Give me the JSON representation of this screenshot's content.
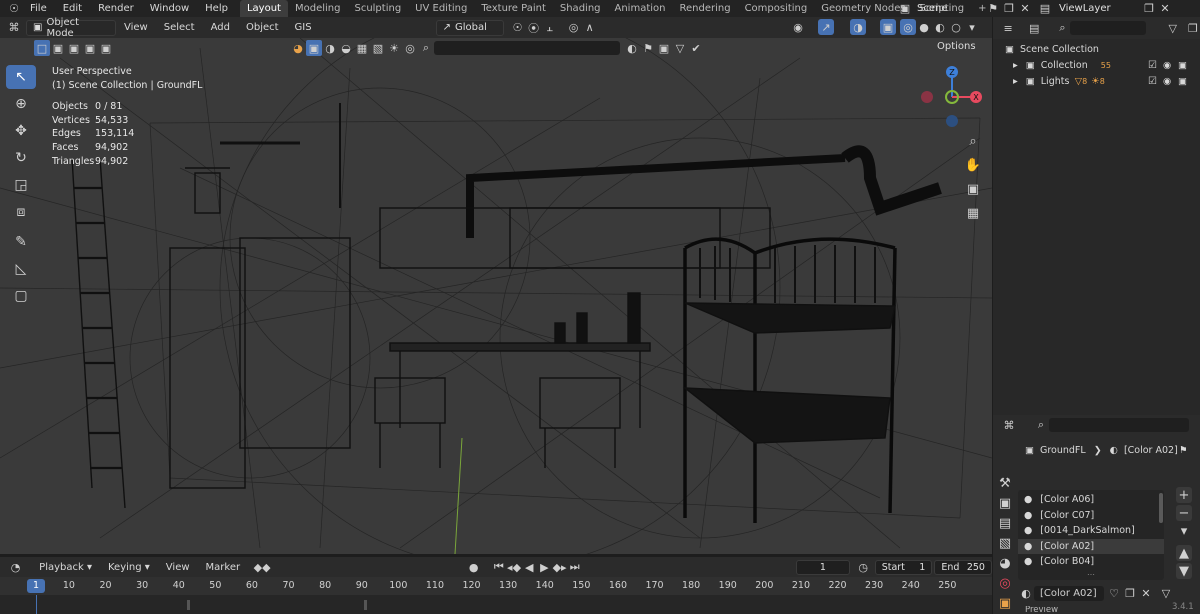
{
  "topbar": {
    "menus": [
      "File",
      "Edit",
      "Render",
      "Window",
      "Help"
    ],
    "workspaces": [
      "Layout",
      "Modeling",
      "Sculpting",
      "UV Editing",
      "Texture Paint",
      "Shading",
      "Animation",
      "Rendering",
      "Compositing",
      "Geometry Nodes",
      "Scripting"
    ],
    "active_workspace": "Layout",
    "scene_label": "Scene",
    "view_layer_label": "ViewLayer"
  },
  "viewport_header": {
    "mode": "Object Mode",
    "menus": [
      "View",
      "Select",
      "Add",
      "Object",
      "GIS"
    ],
    "orientation": "Global",
    "options_label": "Options"
  },
  "viewport": {
    "view_name": "User Perspective",
    "collection_path": "(1) Scene Collection | GroundFL",
    "stats": [
      {
        "label": "Objects",
        "value": "0 / 81"
      },
      {
        "label": "Vertices",
        "value": "54,533"
      },
      {
        "label": "Edges",
        "value": "153,114"
      },
      {
        "label": "Faces",
        "value": "94,902"
      },
      {
        "label": "Triangles",
        "value": "94,902"
      }
    ],
    "gizmo": {
      "x": "X",
      "z": "Z"
    }
  },
  "outliner": {
    "root": "Scene Collection",
    "items": [
      {
        "label": "Collection",
        "badge": "55"
      },
      {
        "label": "Lights",
        "badge_a": "8",
        "badge_b": "8"
      }
    ]
  },
  "properties": {
    "object_name": "GroundFL",
    "material_name": "[Color A02]",
    "materials": [
      "[Color A06]",
      "[Color C07]",
      "[0014_DarkSalmon]",
      "[Color A02]",
      "[Color B04]"
    ],
    "selected_material": "[Color A02]",
    "slot_material": "[Color A02]",
    "preview_label": "Preview"
  },
  "timeline": {
    "menus": [
      "Playback",
      "Keying",
      "View",
      "Marker"
    ],
    "current_frame": "1",
    "start_label": "Start",
    "start_value": "1",
    "end_label": "End",
    "end_value": "250",
    "ticks": [
      "1",
      "10",
      "20",
      "30",
      "40",
      "50",
      "60",
      "70",
      "80",
      "90",
      "100",
      "110",
      "120",
      "130",
      "140",
      "150",
      "160",
      "170",
      "180",
      "190",
      "200",
      "210",
      "220",
      "230",
      "240",
      "250"
    ]
  },
  "status": {
    "version": "3.4.1"
  },
  "colors": {
    "accent": "#4772b3",
    "x_axis": "#e84a5f",
    "y_axis": "#84b83c",
    "z_axis": "#3d7fd9"
  }
}
